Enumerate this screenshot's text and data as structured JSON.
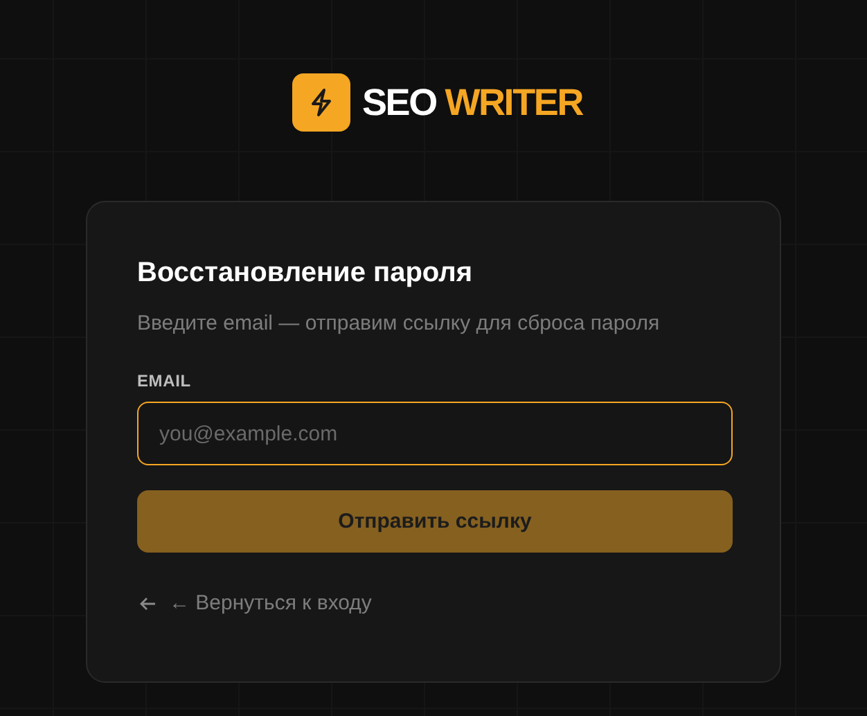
{
  "logo": {
    "word_1": "SEO",
    "word_2": "WRITER"
  },
  "card": {
    "title": "Восстановление пароля",
    "subtitle": "Введите email — отправим ссылку для сброса пароля",
    "email_field": {
      "label": "EMAIL",
      "placeholder": "you@example.com",
      "focused": true
    },
    "submit_button": {
      "label": "Отправить ссылку",
      "disabled": true
    },
    "back_link": {
      "label": "← Вернуться к входу"
    }
  }
}
